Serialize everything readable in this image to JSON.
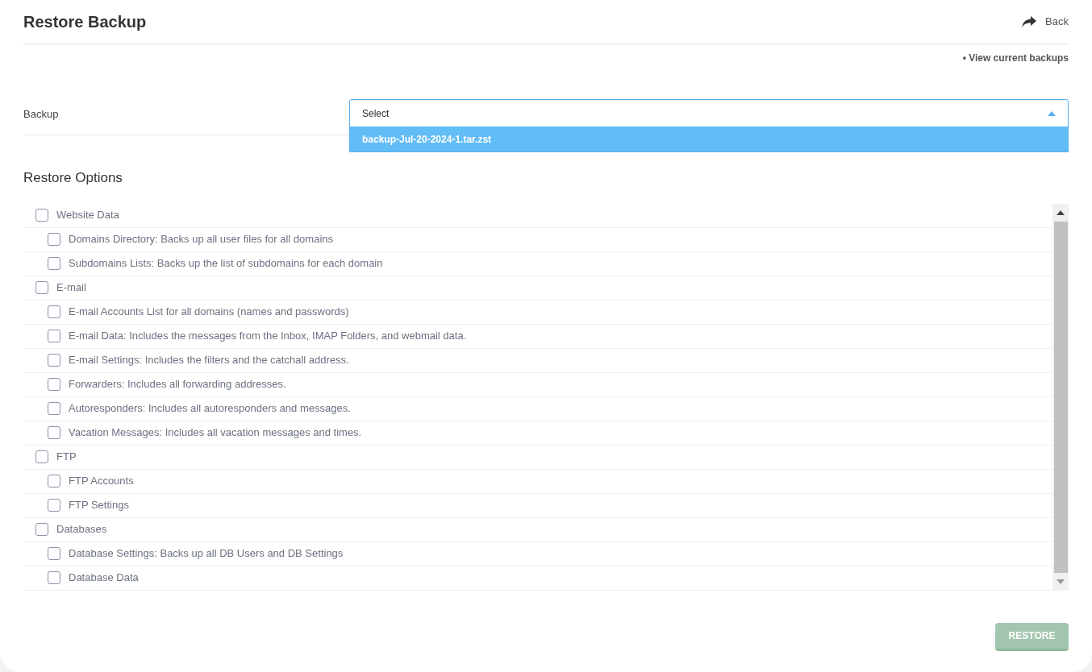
{
  "header": {
    "title": "Restore Backup",
    "back_link": "Back"
  },
  "view_link": "• View current backups",
  "backup": {
    "label": "Backup",
    "placeholder": "Select",
    "expanded": true,
    "options": [
      {
        "label": "backup-Jul-20-2024-1.tar.zst",
        "selected": true
      }
    ]
  },
  "restore_options": {
    "title": "Restore Options",
    "items": [
      {
        "label": "Website Data",
        "checked": false,
        "children": [
          {
            "label": "Domains Directory: Backs up all user files for all domains",
            "checked": false
          },
          {
            "label": "Subdomains Lists: Backs up the list of subdomains for each domain",
            "checked": false
          }
        ]
      },
      {
        "label": "E-mail",
        "checked": false,
        "children": [
          {
            "label": "E-mail Accounts List for all domains (names and passwords)",
            "checked": false
          },
          {
            "label": "E-mail Data: Includes the messages from the Inbox, IMAP Folders, and webmail data.",
            "checked": false
          },
          {
            "label": "E-mail Settings: Includes the filters and the catchall address.",
            "checked": false
          },
          {
            "label": "Forwarders: Includes all forwarding addresses.",
            "checked": false
          },
          {
            "label": "Autoresponders: Includes all autoresponders and messages.",
            "checked": false
          },
          {
            "label": "Vacation Messages: Includes all vacation messages and times.",
            "checked": false
          }
        ]
      },
      {
        "label": "FTP",
        "checked": false,
        "children": [
          {
            "label": "FTP Accounts",
            "checked": false
          },
          {
            "label": "FTP Settings",
            "checked": false
          }
        ]
      },
      {
        "label": "Databases",
        "checked": false,
        "children": [
          {
            "label": "Database Settings: Backs up all DB Users and DB Settings",
            "checked": false
          },
          {
            "label": "Database Data",
            "checked": false
          }
        ]
      }
    ]
  },
  "restore_button": {
    "label": "RESTORE",
    "disabled": true
  }
}
